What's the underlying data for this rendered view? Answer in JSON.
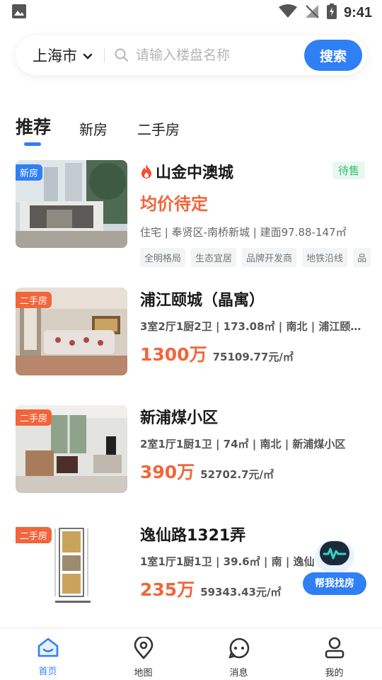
{
  "status_bar": {
    "time": "9:41"
  },
  "search": {
    "city": "上海市",
    "placeholder": "请输入楼盘名称",
    "button": "搜索"
  },
  "tabs": [
    {
      "label": "推荐",
      "active": true
    },
    {
      "label": "新房",
      "active": false
    },
    {
      "label": "二手房",
      "active": false
    }
  ],
  "listings": [
    {
      "badge": "新房",
      "title": "山金中澳城",
      "status": "待售",
      "price": "均价待定",
      "meta": "住宅 | 奉贤区-南桥新城 | 建面97.88-147㎡",
      "tags": [
        "全明格局",
        "生态宜居",
        "品牌开发商",
        "地铁沿线",
        "品"
      ]
    },
    {
      "badge": "二手房",
      "title": "浦江颐城（晶寓）",
      "meta": "3室2厅1厨2卫 | 173.08㎡ | 南北 | 浦江颐城...",
      "total_price": "1300万",
      "unit_price": "75109.77元/㎡"
    },
    {
      "badge": "二手房",
      "title": "新浦煤小区",
      "meta": "2室1厅1厨1卫 | 74㎡ | 南北 | 新浦煤小区",
      "total_price": "390万",
      "unit_price": "52702.7元/㎡"
    },
    {
      "badge": "二手房",
      "title": "逸仙路1321弄",
      "meta": "1室1厅1厨1卫 | 39.6㎡ | 南 | 逸仙路",
      "total_price": "235万",
      "unit_price": "59343.43元/㎡"
    }
  ],
  "helper": {
    "label": "帮我找房"
  },
  "bottom_nav": [
    {
      "label": "首页",
      "icon": "home-icon",
      "active": true
    },
    {
      "label": "地图",
      "icon": "map-pin-icon",
      "active": false
    },
    {
      "label": "消息",
      "icon": "message-icon",
      "active": false
    },
    {
      "label": "我的",
      "icon": "user-icon",
      "active": false
    }
  ],
  "colors": {
    "accent": "#2f7ff5",
    "price": "#f2653a",
    "status_green": "#2fbe72"
  }
}
